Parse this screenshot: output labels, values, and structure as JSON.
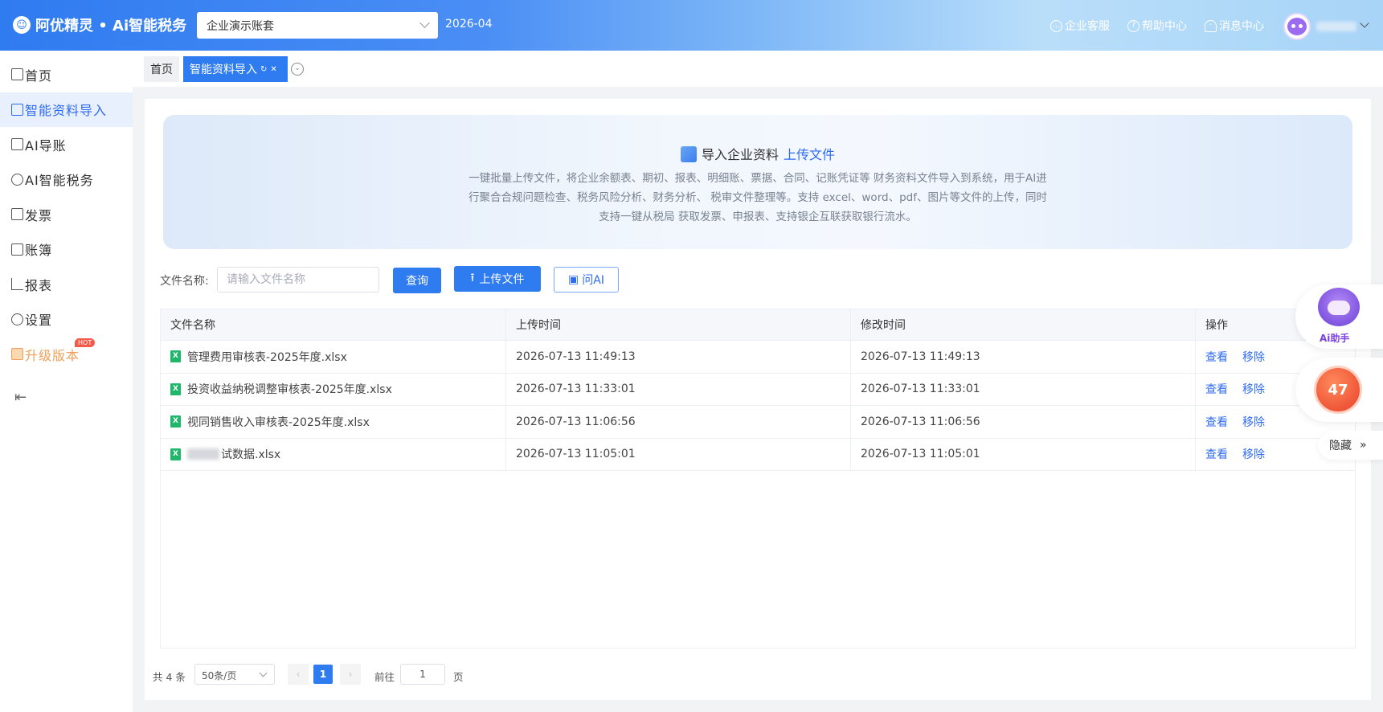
{
  "header": {
    "logo_text": "阿优精灵 • Ai智能税务",
    "company": "企业演示账套",
    "period": "2026-04",
    "links": [
      {
        "label": "企业客服",
        "icon": "chat-icon"
      },
      {
        "label": "帮助中心",
        "icon": "help-icon"
      },
      {
        "label": "消息中心",
        "icon": "bell-icon"
      }
    ]
  },
  "sidebar": {
    "items": [
      {
        "label": "首页",
        "icon": "home-icon"
      },
      {
        "label": "智能资料导入",
        "icon": "import-icon",
        "active": true
      },
      {
        "label": "AI导账",
        "icon": "ai-ledger-icon"
      },
      {
        "label": "AI智能税务",
        "icon": "ai-tax-icon"
      },
      {
        "label": "发票",
        "icon": "invoice-icon"
      },
      {
        "label": "账簿",
        "icon": "book-icon"
      },
      {
        "label": "报表",
        "icon": "chart-icon"
      },
      {
        "label": "设置",
        "icon": "settings-icon"
      },
      {
        "label": "升级版本",
        "icon": "crown-icon"
      }
    ],
    "hot_badge": "HOT"
  },
  "tabs": {
    "home": "首页",
    "active": "智能资料导入"
  },
  "banner": {
    "title": "导入企业资料",
    "link": "上传文件",
    "description": "一键批量上传文件，将企业余额表、期初、报表、明细账、票据、合同、记账凭证等 财务资料文件导入到系统，用于AI进行聚合合规问题检查、税务风险分析、财务分析、 税审文件整理等。支持 excel、word、pdf、图片等文件的上传，同时支持一键从税局 获取发票、申报表、支持银企互联获取银行流水。"
  },
  "search": {
    "label": "文件名称:",
    "placeholder": "请输入文件名称",
    "query_btn": "查询",
    "upload_btn": "上传文件",
    "ask_ai_btn": "问AI"
  },
  "table": {
    "headers": [
      "文件名称",
      "上传时间",
      "修改时间",
      "操作"
    ],
    "rows": [
      {
        "name": "管理费用审核表-2025年度.xlsx",
        "uploaded": "2026-07-13 11:49:13",
        "modified": "2026-07-13 11:49:13"
      },
      {
        "name": "投资收益纳税调整审核表-2025年度.xlsx",
        "uploaded": "2026-07-13 11:33:01",
        "modified": "2026-07-13 11:33:01"
      },
      {
        "name": "视同销售收入审核表-2025年度.xlsx",
        "uploaded": "2026-07-13 11:06:56",
        "modified": "2026-07-13 11:06:56"
      },
      {
        "name": "试数据.xlsx",
        "uploaded": "2026-07-13 11:05:01",
        "modified": "2026-07-13 11:05:01"
      }
    ],
    "actions": {
      "view": "查看",
      "remove": "移除"
    }
  },
  "pager": {
    "total": "共 4 条",
    "page_size": "50条/页",
    "current": "1",
    "goto_label": "前往",
    "goto_value": "1",
    "unit": "页"
  },
  "floating": {
    "ai_label": "Ai助手",
    "timer": "47",
    "hide": "隐藏"
  }
}
